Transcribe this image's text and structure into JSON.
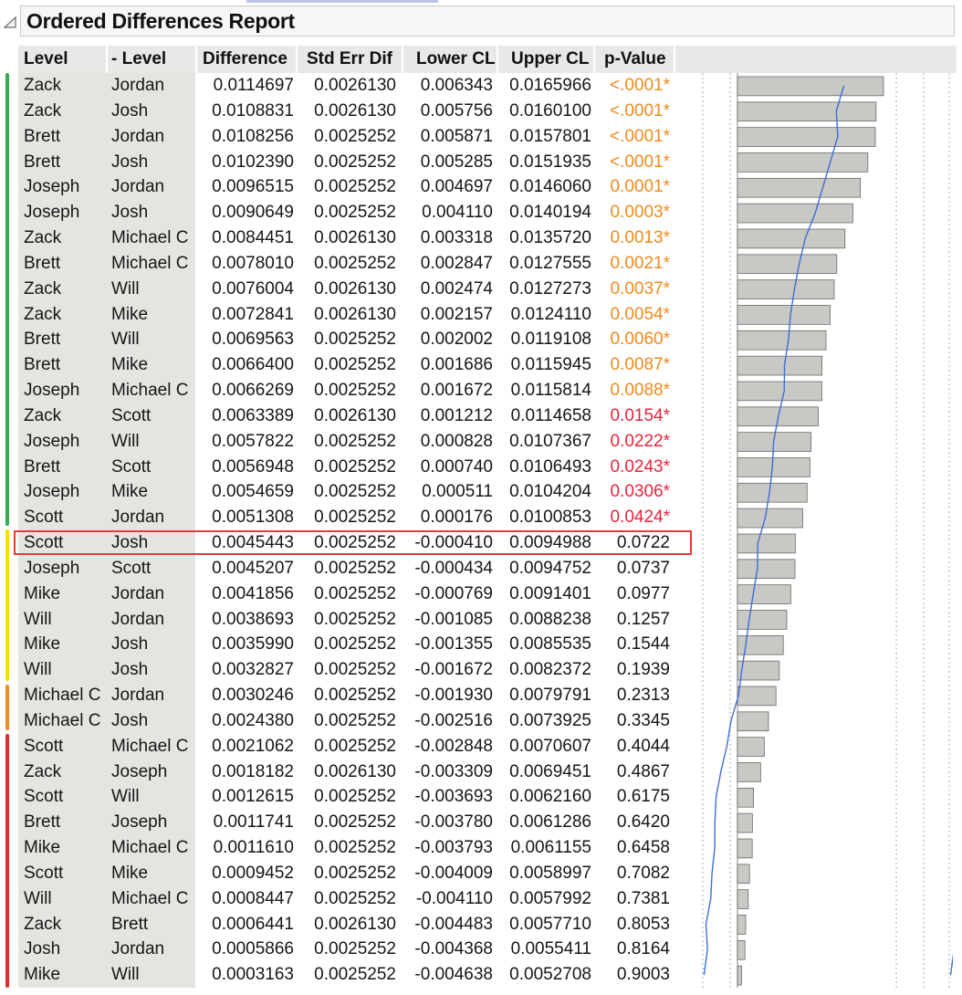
{
  "report": {
    "title": "Ordered Differences Report"
  },
  "columns": {
    "level": "Level",
    "minus_level": "- Level",
    "difference": "Difference",
    "std_err": "Std Err Dif",
    "lower_cl": "Lower CL",
    "upper_cl": "Upper CL",
    "p_value": "p-Value"
  },
  "colors": {
    "significant_pvalue_orange": "#ee8a1e",
    "significant_pvalue_red": "#e8243c",
    "bar_fill": "#c8c8c4",
    "curve": "#3b6fd8",
    "highlight_box": "#e53a3a",
    "group_green": "#2fae4e",
    "group_yellow": "#f2e200",
    "group_orange": "#f28b2a",
    "group_red": "#e32b2b"
  },
  "highlighted_row_index": 18,
  "rows": [
    {
      "level": "Zack",
      "minus_level": "Jordan",
      "difference": "0.0114697",
      "std_err": "0.0026130",
      "lower_cl": "0.006343",
      "upper_cl": "0.0165966",
      "p_value": "<.0001*",
      "group": "green",
      "pclass": "orange"
    },
    {
      "level": "Zack",
      "minus_level": "Josh",
      "difference": "0.0108831",
      "std_err": "0.0026130",
      "lower_cl": "0.005756",
      "upper_cl": "0.0160100",
      "p_value": "<.0001*",
      "group": "green",
      "pclass": "orange"
    },
    {
      "level": "Brett",
      "minus_level": "Jordan",
      "difference": "0.0108256",
      "std_err": "0.0025252",
      "lower_cl": "0.005871",
      "upper_cl": "0.0157801",
      "p_value": "<.0001*",
      "group": "green",
      "pclass": "orange"
    },
    {
      "level": "Brett",
      "minus_level": "Josh",
      "difference": "0.0102390",
      "std_err": "0.0025252",
      "lower_cl": "0.005285",
      "upper_cl": "0.0151935",
      "p_value": "<.0001*",
      "group": "green",
      "pclass": "orange"
    },
    {
      "level": "Joseph",
      "minus_level": "Jordan",
      "difference": "0.0096515",
      "std_err": "0.0025252",
      "lower_cl": "0.004697",
      "upper_cl": "0.0146060",
      "p_value": "0.0001*",
      "group": "green",
      "pclass": "orange"
    },
    {
      "level": "Joseph",
      "minus_level": "Josh",
      "difference": "0.0090649",
      "std_err": "0.0025252",
      "lower_cl": "0.004110",
      "upper_cl": "0.0140194",
      "p_value": "0.0003*",
      "group": "green",
      "pclass": "orange"
    },
    {
      "level": "Zack",
      "minus_level": "Michael C",
      "difference": "0.0084451",
      "std_err": "0.0026130",
      "lower_cl": "0.003318",
      "upper_cl": "0.0135720",
      "p_value": "0.0013*",
      "group": "green",
      "pclass": "orange"
    },
    {
      "level": "Brett",
      "minus_level": "Michael C",
      "difference": "0.0078010",
      "std_err": "0.0025252",
      "lower_cl": "0.002847",
      "upper_cl": "0.0127555",
      "p_value": "0.0021*",
      "group": "green",
      "pclass": "orange"
    },
    {
      "level": "Zack",
      "minus_level": "Will",
      "difference": "0.0076004",
      "std_err": "0.0026130",
      "lower_cl": "0.002474",
      "upper_cl": "0.0127273",
      "p_value": "0.0037*",
      "group": "green",
      "pclass": "orange"
    },
    {
      "level": "Zack",
      "minus_level": "Mike",
      "difference": "0.0072841",
      "std_err": "0.0026130",
      "lower_cl": "0.002157",
      "upper_cl": "0.0124110",
      "p_value": "0.0054*",
      "group": "green",
      "pclass": "orange"
    },
    {
      "level": "Brett",
      "minus_level": "Will",
      "difference": "0.0069563",
      "std_err": "0.0025252",
      "lower_cl": "0.002002",
      "upper_cl": "0.0119108",
      "p_value": "0.0060*",
      "group": "green",
      "pclass": "orange"
    },
    {
      "level": "Brett",
      "minus_level": "Mike",
      "difference": "0.0066400",
      "std_err": "0.0025252",
      "lower_cl": "0.001686",
      "upper_cl": "0.0115945",
      "p_value": "0.0087*",
      "group": "green",
      "pclass": "orange"
    },
    {
      "level": "Joseph",
      "minus_level": "Michael C",
      "difference": "0.0066269",
      "std_err": "0.0025252",
      "lower_cl": "0.001672",
      "upper_cl": "0.0115814",
      "p_value": "0.0088*",
      "group": "green",
      "pclass": "orange"
    },
    {
      "level": "Zack",
      "minus_level": "Scott",
      "difference": "0.0063389",
      "std_err": "0.0026130",
      "lower_cl": "0.001212",
      "upper_cl": "0.0114658",
      "p_value": "0.0154*",
      "group": "green",
      "pclass": "red"
    },
    {
      "level": "Joseph",
      "minus_level": "Will",
      "difference": "0.0057822",
      "std_err": "0.0025252",
      "lower_cl": "0.000828",
      "upper_cl": "0.0107367",
      "p_value": "0.0222*",
      "group": "green",
      "pclass": "red"
    },
    {
      "level": "Brett",
      "minus_level": "Scott",
      "difference": "0.0056948",
      "std_err": "0.0025252",
      "lower_cl": "0.000740",
      "upper_cl": "0.0106493",
      "p_value": "0.0243*",
      "group": "green",
      "pclass": "red"
    },
    {
      "level": "Joseph",
      "minus_level": "Mike",
      "difference": "0.0054659",
      "std_err": "0.0025252",
      "lower_cl": "0.000511",
      "upper_cl": "0.0104204",
      "p_value": "0.0306*",
      "group": "green",
      "pclass": "red"
    },
    {
      "level": "Scott",
      "minus_level": "Jordan",
      "difference": "0.0051308",
      "std_err": "0.0025252",
      "lower_cl": "0.000176",
      "upper_cl": "0.0100853",
      "p_value": "0.0424*",
      "group": "green",
      "pclass": "red"
    },
    {
      "level": "Scott",
      "minus_level": "Josh",
      "difference": "0.0045443",
      "std_err": "0.0025252",
      "lower_cl": "-0.000410",
      "upper_cl": "0.0094988",
      "p_value": "0.0722",
      "group": "yellow",
      "pclass": "plain"
    },
    {
      "level": "Joseph",
      "minus_level": "Scott",
      "difference": "0.0045207",
      "std_err": "0.0025252",
      "lower_cl": "-0.000434",
      "upper_cl": "0.0094752",
      "p_value": "0.0737",
      "group": "yellow",
      "pclass": "plain"
    },
    {
      "level": "Mike",
      "minus_level": "Jordan",
      "difference": "0.0041856",
      "std_err": "0.0025252",
      "lower_cl": "-0.000769",
      "upper_cl": "0.0091401",
      "p_value": "0.0977",
      "group": "yellow",
      "pclass": "plain"
    },
    {
      "level": "Will",
      "minus_level": "Jordan",
      "difference": "0.0038693",
      "std_err": "0.0025252",
      "lower_cl": "-0.001085",
      "upper_cl": "0.0088238",
      "p_value": "0.1257",
      "group": "yellow",
      "pclass": "plain"
    },
    {
      "level": "Mike",
      "minus_level": "Josh",
      "difference": "0.0035990",
      "std_err": "0.0025252",
      "lower_cl": "-0.001355",
      "upper_cl": "0.0085535",
      "p_value": "0.1544",
      "group": "yellow",
      "pclass": "plain"
    },
    {
      "level": "Will",
      "minus_level": "Josh",
      "difference": "0.0032827",
      "std_err": "0.0025252",
      "lower_cl": "-0.001672",
      "upper_cl": "0.0082372",
      "p_value": "0.1939",
      "group": "yellow",
      "pclass": "plain"
    },
    {
      "level": "Michael C",
      "minus_level": "Jordan",
      "difference": "0.0030246",
      "std_err": "0.0025252",
      "lower_cl": "-0.001930",
      "upper_cl": "0.0079791",
      "p_value": "0.2313",
      "group": "orange",
      "pclass": "plain"
    },
    {
      "level": "Michael C",
      "minus_level": "Josh",
      "difference": "0.0024380",
      "std_err": "0.0025252",
      "lower_cl": "-0.002516",
      "upper_cl": "0.0073925",
      "p_value": "0.3345",
      "group": "orange",
      "pclass": "plain"
    },
    {
      "level": "Scott",
      "minus_level": "Michael C",
      "difference": "0.0021062",
      "std_err": "0.0025252",
      "lower_cl": "-0.002848",
      "upper_cl": "0.0070607",
      "p_value": "0.4044",
      "group": "red",
      "pclass": "plain"
    },
    {
      "level": "Zack",
      "minus_level": "Joseph",
      "difference": "0.0018182",
      "std_err": "0.0026130",
      "lower_cl": "-0.003309",
      "upper_cl": "0.0069451",
      "p_value": "0.4867",
      "group": "red",
      "pclass": "plain"
    },
    {
      "level": "Scott",
      "minus_level": "Will",
      "difference": "0.0012615",
      "std_err": "0.0025252",
      "lower_cl": "-0.003693",
      "upper_cl": "0.0062160",
      "p_value": "0.6175",
      "group": "red",
      "pclass": "plain"
    },
    {
      "level": "Brett",
      "minus_level": "Joseph",
      "difference": "0.0011741",
      "std_err": "0.0025252",
      "lower_cl": "-0.003780",
      "upper_cl": "0.0061286",
      "p_value": "0.6420",
      "group": "red",
      "pclass": "plain"
    },
    {
      "level": "Mike",
      "minus_level": "Michael C",
      "difference": "0.0011610",
      "std_err": "0.0025252",
      "lower_cl": "-0.003793",
      "upper_cl": "0.0061155",
      "p_value": "0.6458",
      "group": "red",
      "pclass": "plain"
    },
    {
      "level": "Scott",
      "minus_level": "Mike",
      "difference": "0.0009452",
      "std_err": "0.0025252",
      "lower_cl": "-0.004009",
      "upper_cl": "0.0058997",
      "p_value": "0.7082",
      "group": "red",
      "pclass": "plain"
    },
    {
      "level": "Will",
      "minus_level": "Michael C",
      "difference": "0.0008447",
      "std_err": "0.0025252",
      "lower_cl": "-0.004110",
      "upper_cl": "0.0057992",
      "p_value": "0.7381",
      "group": "red",
      "pclass": "plain"
    },
    {
      "level": "Zack",
      "minus_level": "Brett",
      "difference": "0.0006441",
      "std_err": "0.0026130",
      "lower_cl": "-0.004483",
      "upper_cl": "0.0057710",
      "p_value": "0.8053",
      "group": "red",
      "pclass": "plain"
    },
    {
      "level": "Josh",
      "minus_level": "Jordan",
      "difference": "0.0005866",
      "std_err": "0.0025252",
      "lower_cl": "-0.004368",
      "upper_cl": "0.0055411",
      "p_value": "0.8164",
      "group": "red",
      "pclass": "plain"
    },
    {
      "level": "Mike",
      "minus_level": "Will",
      "difference": "0.0003163",
      "std_err": "0.0025252",
      "lower_cl": "-0.004638",
      "upper_cl": "0.0052708",
      "p_value": "0.9003",
      "group": "red",
      "pclass": "plain"
    }
  ]
}
